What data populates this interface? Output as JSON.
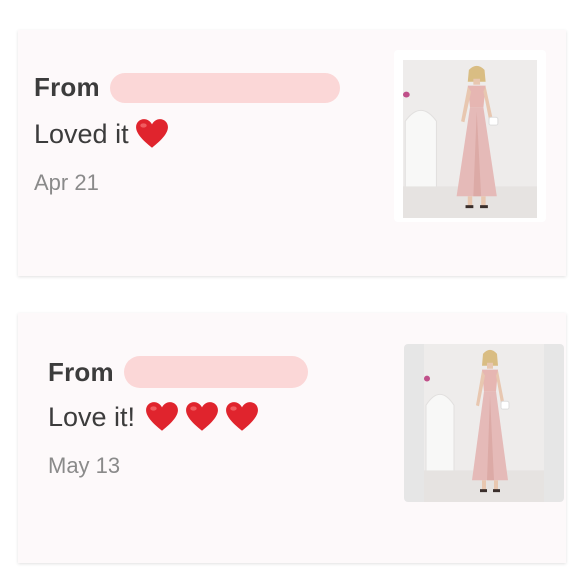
{
  "messages": [
    {
      "from_label": "From",
      "text": "Loved it",
      "hearts": 1,
      "date": "Apr 21",
      "photo_icon": "product-photo-dress"
    },
    {
      "from_label": "From",
      "text": "Love it!",
      "hearts": 3,
      "date": "May 13",
      "photo_icon": "product-photo-dress"
    }
  ],
  "colors": {
    "card_bg": "#fdf9fa",
    "redaction": "#fbd7d7",
    "heart": "#e0242d",
    "text": "#3c3c3c",
    "date": "#8a8a8a"
  }
}
